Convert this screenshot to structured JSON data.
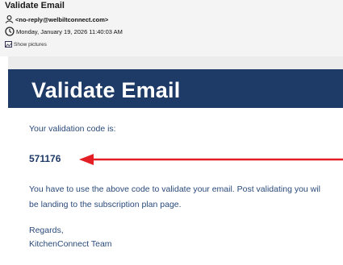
{
  "email": {
    "subject": "Validate Email",
    "from": "<no-reply@welbiltconnect.com>",
    "date": "Monday, January 19, 2026 11:40:03 AM",
    "show_pictures": "Show pictures"
  },
  "body": {
    "banner_title": "Validate Email",
    "intro": "Your validation code is:",
    "code": "571176",
    "instruction_line1": "You have to use the above code to validate your email. Post validating you wil",
    "instruction_line2": "be landing to the subscription plan page.",
    "regards": "Regards,",
    "signature": "KitchenConnect Team"
  },
  "colors": {
    "banner": "#1e3a66",
    "arrow": "#e31e24",
    "text": "#2a4a7a"
  },
  "icons": [
    "person-icon",
    "clock-icon",
    "image-icon"
  ]
}
